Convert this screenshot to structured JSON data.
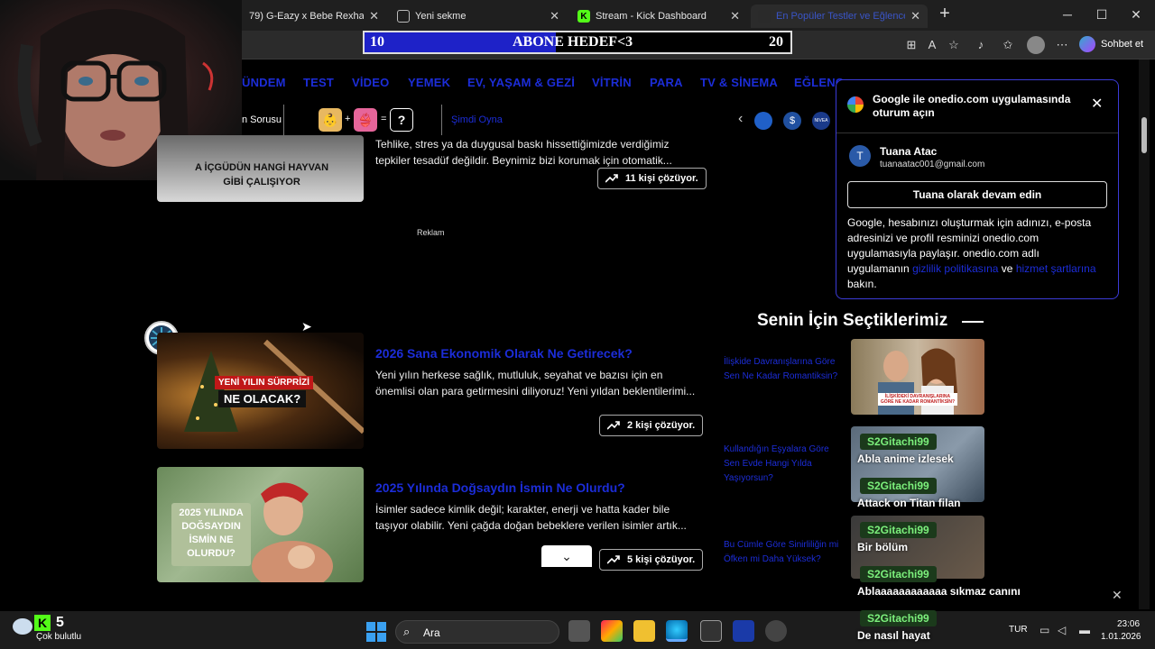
{
  "browser": {
    "tabs": [
      {
        "title": "79) G-Eazy x Bebe Rexha - Me, M",
        "icon": "youtube-icon"
      },
      {
        "title": "Yeni sekme",
        "icon": "newtab-icon"
      },
      {
        "title": "Stream - Kick Dashboard",
        "icon": "kick-icon"
      },
      {
        "title": "En Popüler Testler ve Eğlenceli Q",
        "icon": "onedio-icon"
      }
    ],
    "new_tab": "+",
    "minimize": "─",
    "maximize": "☐",
    "close": "✕",
    "sohbet": "Sohbet et"
  },
  "overlay": {
    "goal_start": "10",
    "goal_label": "ABONE HEDEF<3",
    "goal_end": "20",
    "goal_progress": 0.45
  },
  "nav": {
    "items": [
      "ÜNDEM",
      "TEST",
      "VİDEO",
      "YEMEK",
      "EV, YAŞAM & GEZİ",
      "VİTRİN",
      "PARA",
      "TV & SİNEMA",
      "EĞLENC"
    ]
  },
  "subbar": {
    "label": "n Sorusu",
    "plus": "+",
    "equals": "=",
    "question": "?",
    "play_now": "Şimdi Oyna",
    "prev_arrow": "‹",
    "nivea": "NIVEA"
  },
  "cards": [
    {
      "thumb_text": "A İÇGÜDÜN HANGİ HAYVAN GİBİ ÇALIŞIYOR",
      "title": "",
      "desc1": "Tehlike, stres ya da duygusal baskı hissettiğimizde verdiğimiz",
      "desc2": "tepkiler tesadüf değildir. Beynimiz bizi korumak için otomatik...",
      "solve": "11 kişi çözüyor."
    },
    {
      "thumb_text1": "YENİ YILIN SÜRPRİZİ",
      "thumb_text2": "NE OLACAK?",
      "title": "2026 Sana Ekonomik Olarak Ne Getirecek?",
      "desc1": "Yeni yılın herkese sağlık, mutluluk, seyahat ve bazısı için en",
      "desc2": "önemlisi olan para getirmesini diliyoruz! Yeni yıldan beklentilerimi...",
      "solve": "2 kişi çözüyor."
    },
    {
      "thumb_text": "2025 YILINDA DOĞSAYDIN İSMİN NE OLURDU?",
      "title": "2025 Yılında Doğsaydın İsmin Ne Olurdu?",
      "desc1": "İsimler sadece kimlik değil; karakter, enerji ve hatta kader bile",
      "desc2": "taşıyor olabilir. Yeni çağda doğan bebeklere verilen isimler artık...",
      "solve": "5 kişi çözüyor."
    }
  ],
  "ad_label": "Reklam",
  "google_popup": {
    "title": "Google ile onedio.com uygulamasında oturum açın",
    "user_initial": "T",
    "user_name": "Tuana Atac",
    "user_email": "tuanaatac001@gmail.com",
    "continue_button": "Tuana olarak devam edin",
    "body1": "Google, hesabınızı oluşturmak için adınızı, e-posta",
    "body2": "adresinizi ve profil resminizi onedio.com",
    "body3": "uygulamasıyla paylaşır. onedio.com adlı",
    "body4_pre": "uygulamanın",
    "privacy_link": "gizlilik politikasına",
    "body4_mid": "ve",
    "terms_link": "hizmet şartlarına",
    "body5": "bakın.",
    "close": "✕"
  },
  "suggestions": {
    "heading": "Senin İçin Seçtiklerimiz",
    "links": [
      "İlişkide Davranışlarına Göre Sen Ne Kadar Romantiksin?",
      "Kullandığın Eşyalara Göre Sen Evde Hangi Yılda Yaşıyorsun?",
      "Bu Cümle Göre Sinirliliğin mi Öfken mi Daha Yüksek?"
    ],
    "thumb_caption": "İLİŞKİDEKİ DAVRANIŞLARINA GÖRE NE KADAR ROMANTİKSİN?"
  },
  "chat": [
    {
      "name": "S2Gitachi99",
      "message": "Abla anime izlesek"
    },
    {
      "name": "S2Gitachi99",
      "message": "Attack on Titan filan"
    },
    {
      "name": "S2Gitachi99",
      "message": "Bir bölüm"
    },
    {
      "name": "S2Gitachi99",
      "message": "Ablaaaaaaaaaaaa sıkmaz canını"
    },
    {
      "name": "S2Gitachi99",
      "message": "De nasıl hayat"
    }
  ],
  "taskbar": {
    "weather_value": "5",
    "weather_text": "Çok bulutlu",
    "search_placeholder": "Ara",
    "lang": "TUR",
    "time": "23:06",
    "date": "1.01.2026"
  },
  "page_close": "✕"
}
